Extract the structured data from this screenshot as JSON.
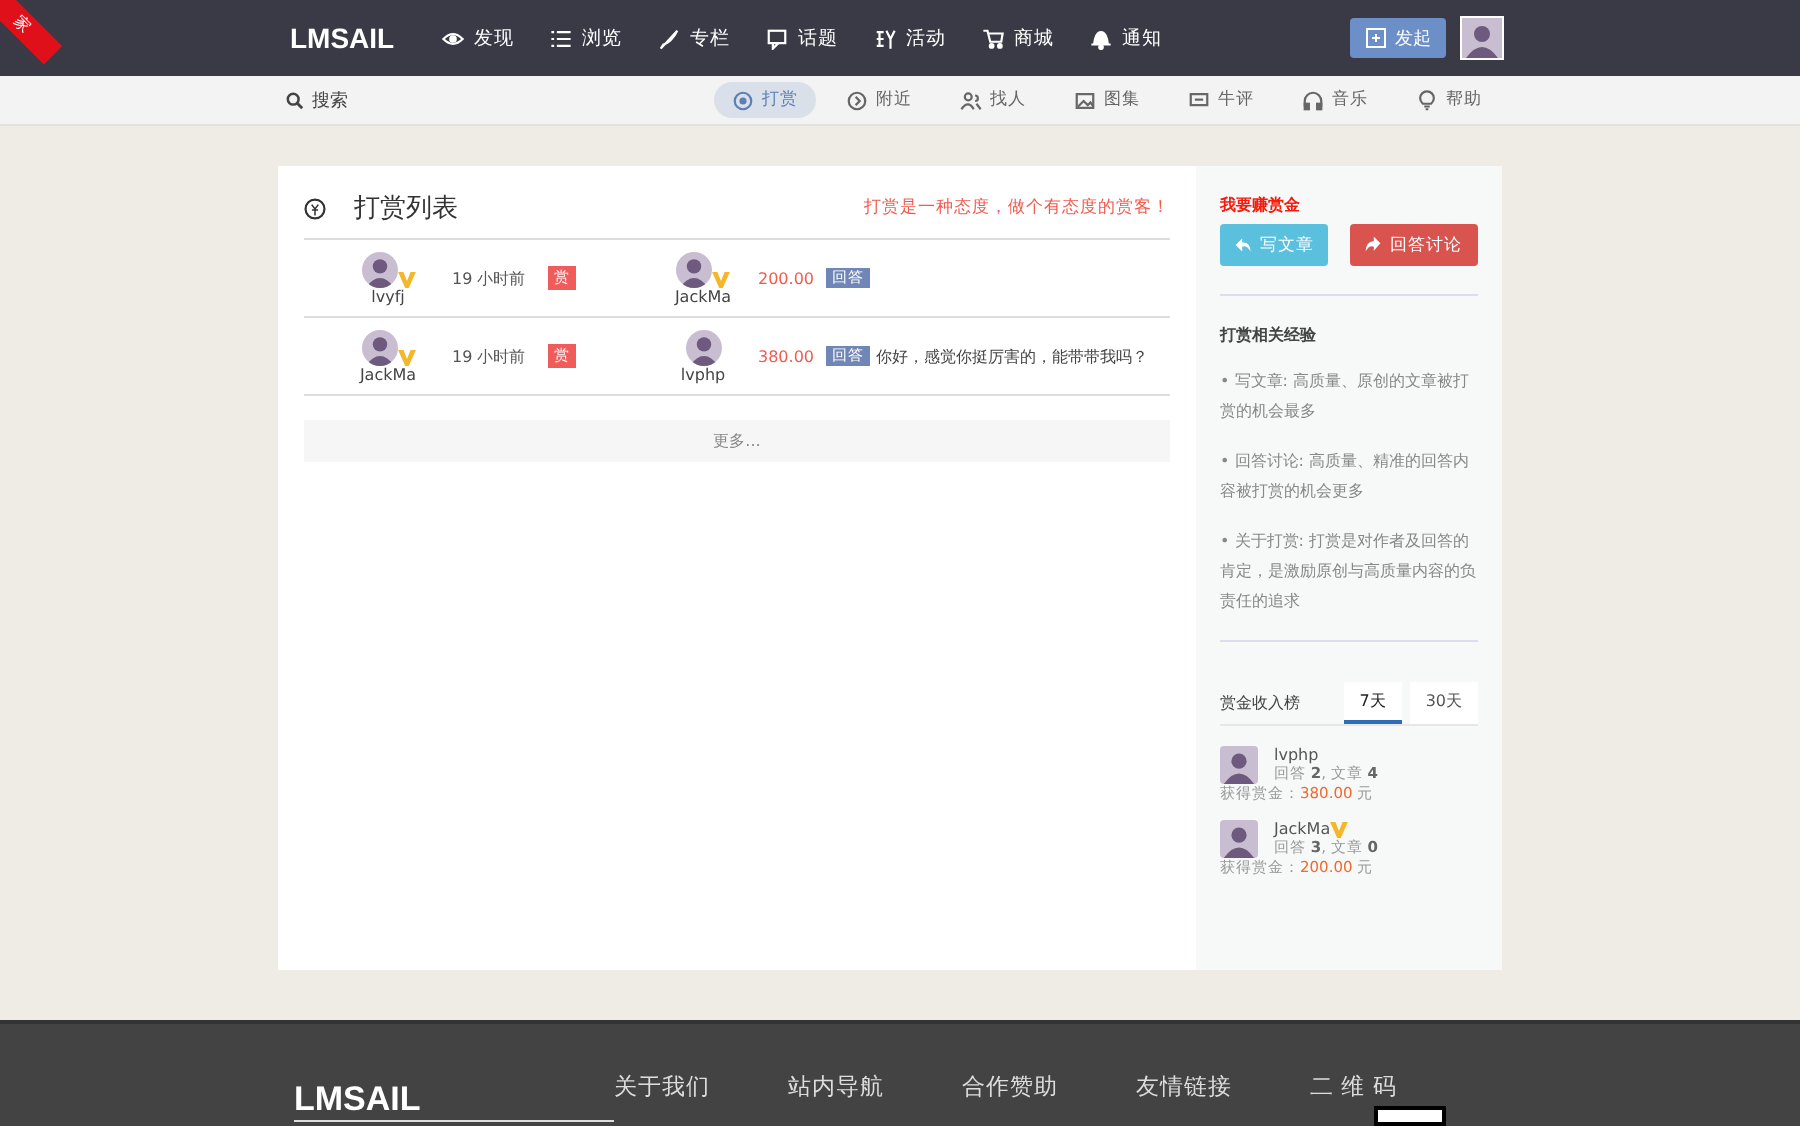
{
  "ribbon": "家",
  "header": {
    "logo": "LMSAIL",
    "nav": [
      {
        "label": "发现"
      },
      {
        "label": "浏览"
      },
      {
        "label": "专栏"
      },
      {
        "label": "话题"
      },
      {
        "label": "活动"
      },
      {
        "label": "商城"
      },
      {
        "label": "通知"
      }
    ],
    "post_button": "发起"
  },
  "subnav": {
    "search": "搜索",
    "items": [
      {
        "label": "打赏",
        "selected": true
      },
      {
        "label": "附近",
        "selected": false
      },
      {
        "label": "找人",
        "selected": false
      },
      {
        "label": "图集",
        "selected": false
      },
      {
        "label": "牛评",
        "selected": false
      },
      {
        "label": "音乐",
        "selected": false
      },
      {
        "label": "帮助",
        "selected": false
      }
    ]
  },
  "reward_list": {
    "title": "打赏列表",
    "slogan": "打赏是一种态度，做个有态度的赏客！",
    "rows": [
      {
        "giver": {
          "name": "lvyfj",
          "vip": true
        },
        "time": "19 小时前",
        "tag": "赏",
        "receiver": {
          "name": "JackMa",
          "vip": true
        },
        "amount": "200.00",
        "type": "回答"
      },
      {
        "giver": {
          "name": "JackMa",
          "vip": true
        },
        "time": "19 小时前",
        "tag": "赏",
        "receiver": {
          "name": "lvphp",
          "vip": false
        },
        "amount": "380.00",
        "type": "回答",
        "text": "你好，感觉你挺厉害的，能带带我吗？"
      }
    ],
    "more": "更多..."
  },
  "sidebar": {
    "earn_title": "我要赚赏金",
    "buttons": [
      {
        "label": "写文章",
        "kind": "write"
      },
      {
        "label": "回答讨论",
        "kind": "answer"
      }
    ],
    "tips_title": "打赏相关经验",
    "tips": [
      "• 写文章: 高质量、原创的文章被打赏的机会最多",
      "• 回答讨论: 高质量、精准的回答内容被打赏的机会更多",
      "• 关于打赏: 打赏是对作者及回答的肯定，是激励原创与高质量内容的负责任的追求"
    ],
    "ranking": {
      "title": "赏金收入榜",
      "tabs": [
        {
          "label": "7天",
          "selected": true
        },
        {
          "label": "30天",
          "selected": false
        }
      ],
      "entries": [
        {
          "name": "lvphp",
          "vip": false,
          "stats": "回答 **2**, 文章 **4**",
          "earn_label": "获得赏金：",
          "amount": "380.00",
          "unit": "元"
        },
        {
          "name": "JackMa",
          "vip": true,
          "stats": "回答 **3**, 文章 **0**",
          "earn_label": "获得赏金：",
          "amount": "200.00",
          "unit": "元"
        }
      ]
    }
  },
  "footer": {
    "logo": "LMSAIL",
    "headings": [
      "关于我们",
      "站内导航",
      "合作赞助",
      "友情链接",
      "二 维 码"
    ]
  }
}
